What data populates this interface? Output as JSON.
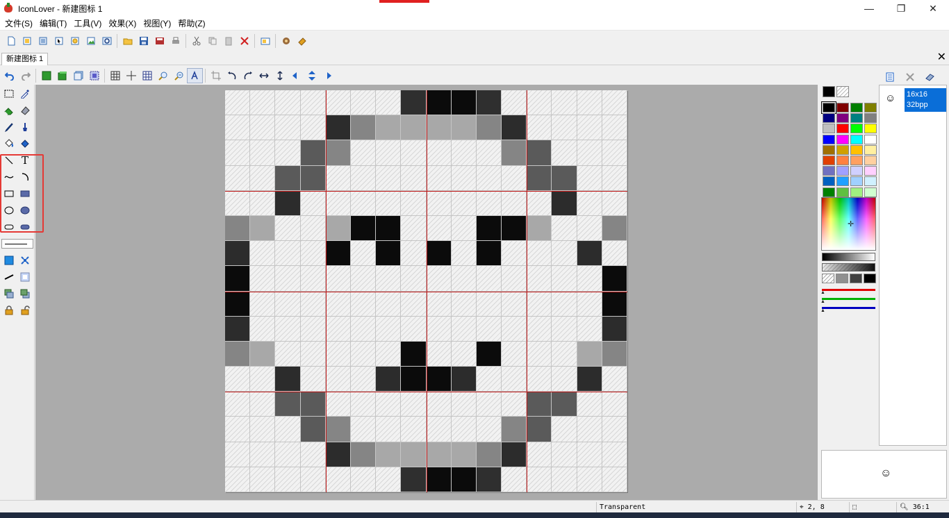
{
  "window": {
    "app_name": "IconLover",
    "title": "IconLover - 新建图标 1",
    "controls": {
      "minimize": "—",
      "maximize": "❐",
      "close": "✕"
    }
  },
  "menu": {
    "items": [
      "文件(S)",
      "编辑(T)",
      "工具(V)",
      "效果(X)",
      "视图(Y)",
      "帮助(Z)"
    ]
  },
  "toolbar": {
    "buttons": [
      "new-icon",
      "new-library-icon",
      "new-page-icon",
      "new-cursor-icon",
      "import-icon",
      "new-image-icon",
      "extract-icon",
      "open-folder-icon",
      "save-icon",
      "save-all-icon",
      "print-icon",
      "cut-icon",
      "copy-icon",
      "paste-icon",
      "delete-icon",
      "properties-icon",
      "icon-wizard-icon",
      "help-book-icon"
    ]
  },
  "document": {
    "tab_label": "新建图标 1",
    "close_glyph": "✕"
  },
  "editor_toolbar": {
    "buttons": [
      "undo-icon",
      "redo-icon",
      "fill-green-icon",
      "layer-green-icon",
      "layer-3d-icon",
      "select-all-icon",
      "grid-icon",
      "crosshair-icon",
      "hatch-grid-icon",
      "zoom-in-icon",
      "zoom-out-icon",
      "text-aa-icon",
      "crop-icon",
      "rotate-left-icon",
      "rotate-right-icon",
      "flip-horizontal-icon",
      "flip-vertical-icon",
      "shift-left-icon",
      "shift-vertical-icon",
      "shift-right-icon"
    ]
  },
  "left_tools": {
    "text_tool_glyph": "T"
  },
  "icon_editor": {
    "size": 16,
    "grid_lines": [
      4,
      8,
      12
    ],
    "pixels": [
      ".......#XX#.....",
      "....D+LLLL+D....",
      "...M+......+M...",
      "..MM........MM..",
      "..D..........D..",
      "+L..LXX...XXL..+",
      "D...X.X.X.X...D.",
      "X..............X",
      "X..............X",
      "D..............D",
      "+L.....X..X...L+",
      "..D...DXXD....D.",
      "..MM........MM..",
      "...M+......+M...",
      "....D+LLLL+D....",
      ".......#XX#....."
    ]
  },
  "palette": {
    "primary": "#000000",
    "rows": [
      [
        "#000000",
        "#800000",
        "#008000",
        "#808000"
      ],
      [
        "#000080",
        "#800080",
        "#008080",
        "#808080"
      ],
      [
        "#c0c0c0",
        "#ff0000",
        "#00ff00",
        "#ffff00"
      ],
      [
        "#0000ff",
        "#ff00ff",
        "#00ffff",
        "#ffffff"
      ],
      [
        "#a07000",
        "#d0a000",
        "#ffc000",
        "#fff0a0"
      ],
      [
        "#e04000",
        "#ff8040",
        "#ffa060",
        "#ffd0a0"
      ],
      [
        "#7070c0",
        "#a0a0ff",
        "#d0d0ff",
        "#ffd0ff"
      ],
      [
        "#0060c0",
        "#20a0ff",
        "#a0d0ff",
        "#d0f0ff"
      ],
      [
        "#008000",
        "#60c040",
        "#a0f080",
        "#d0ffd0"
      ]
    ],
    "grays": [
      "#c8c8c8",
      "#909090",
      "#404040",
      "#000000"
    ]
  },
  "formats": {
    "items": [
      {
        "size": "16x16",
        "depth": "32bpp"
      }
    ],
    "smiley_glyph": "☺"
  },
  "status": {
    "color": "Transparent",
    "cursor": "2, 8",
    "zoom": "36:1"
  }
}
